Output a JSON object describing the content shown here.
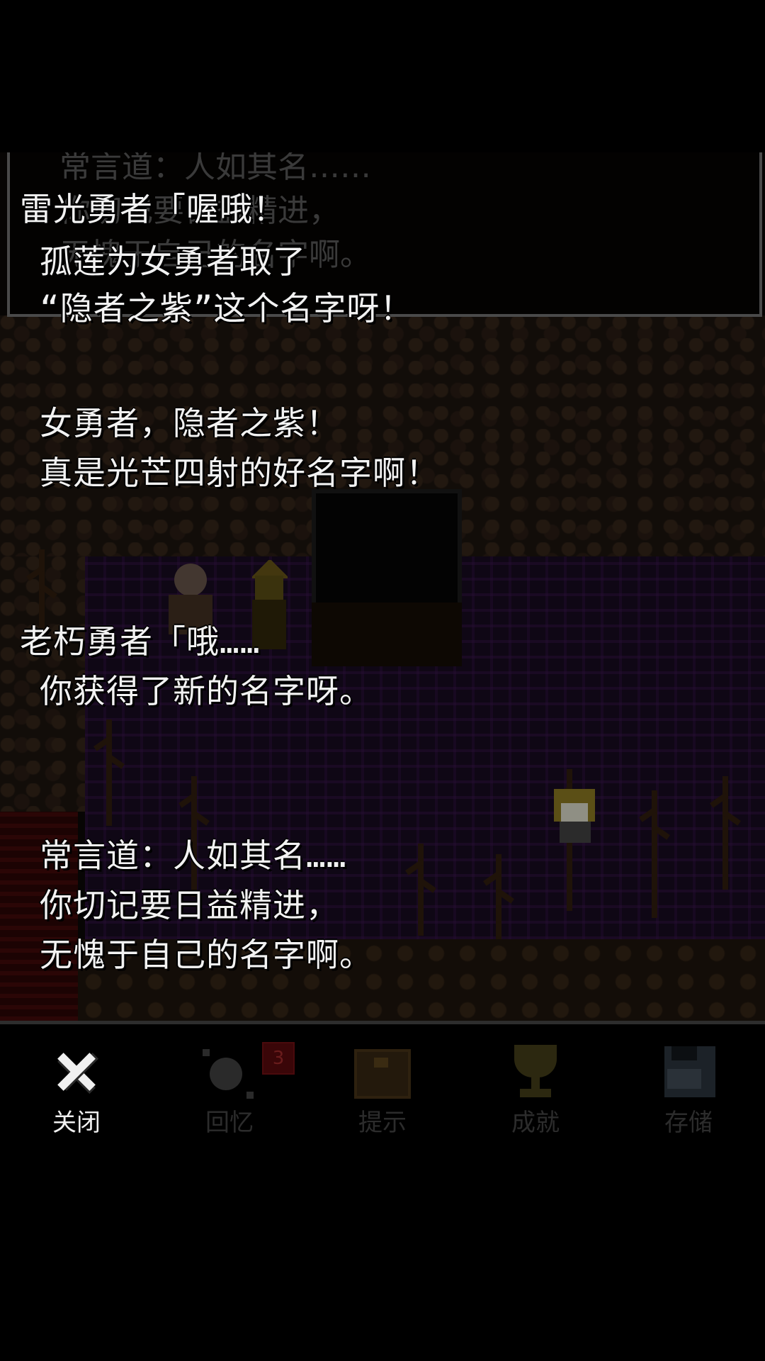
{
  "dialogue_log": [
    {
      "speaker_line": "雷光勇者「喔哦！",
      "lines": [
        "孤莲为女勇者取了",
        "“隐者之紫”这个名字呀！",
        "",
        "女勇者，隐者之紫！",
        "真是光芒四射的好名字啊！"
      ]
    },
    {
      "speaker_line": "老朽勇者「哦……",
      "lines": [
        "你获得了新的名字呀。",
        "",
        "",
        "常言道：人如其名……",
        "你切记要日益精进，",
        "无愧于自己的名字啊。"
      ]
    }
  ],
  "ghost_text": [
    "常言道：人如其名……",
    "你切记要日益精进，",
    "无愧于自己的名字啊。"
  ],
  "menu": {
    "items": [
      {
        "id": "close",
        "label": "关闭",
        "icon": "close-icon",
        "active": true
      },
      {
        "id": "memory",
        "label": "回忆",
        "icon": "memory-icon",
        "badge": "3",
        "active": false
      },
      {
        "id": "hint",
        "label": "提示",
        "icon": "chest-icon",
        "active": false
      },
      {
        "id": "achievement",
        "label": "成就",
        "icon": "trophy-icon",
        "active": false
      },
      {
        "id": "save",
        "label": "存储",
        "icon": "floppy-icon",
        "active": false
      }
    ]
  },
  "colors": {
    "text": "#f2f2f2",
    "menu_active": "#f0f0f0",
    "menu_inactive": "#2c2c2c",
    "badge": "#3a0608"
  }
}
